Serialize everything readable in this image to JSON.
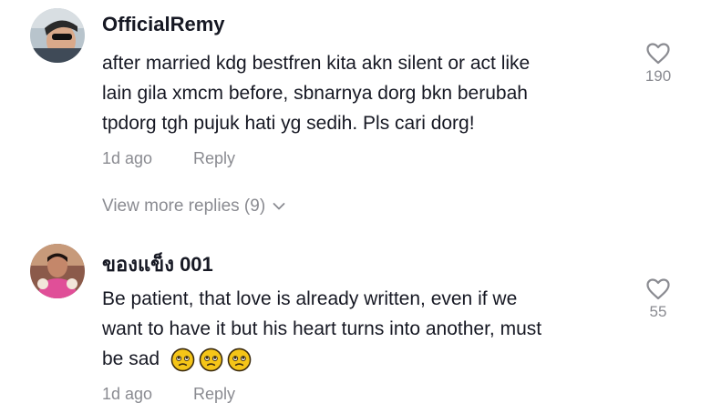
{
  "comments": [
    {
      "username": "OfficialRemy",
      "lines": [
        "after married kdg bestfren kita akn silent or act like",
        "lain gila xmcm before, sbnarnya dorg bkn berubah",
        "tpdorg tgh pujuk hati yg sedih. Pls cari dorg!"
      ],
      "time": "1d ago",
      "reply_label": "Reply",
      "likes": "190",
      "avatar_icon": "user-avatar-sunglasses"
    },
    {
      "username": "ของแข็ง 001",
      "lines": [
        "Be patient, that love is already written, even if we",
        "want to have it but his heart turns into another, must",
        "be sad"
      ],
      "emojis": [
        "pleading-face-emoji",
        "pleading-face-emoji",
        "pleading-face-emoji"
      ],
      "time": "1d ago",
      "reply_label": "Reply",
      "likes": "55",
      "avatar_icon": "user-avatar-pink-shirt"
    }
  ],
  "view_more": "View more replies (9)",
  "icons": {
    "like": "heart-outline-icon",
    "expand": "chevron-down-icon"
  },
  "colors": {
    "text": "#161823",
    "muted": "#8a8b91",
    "emoji": "#f5c518"
  }
}
